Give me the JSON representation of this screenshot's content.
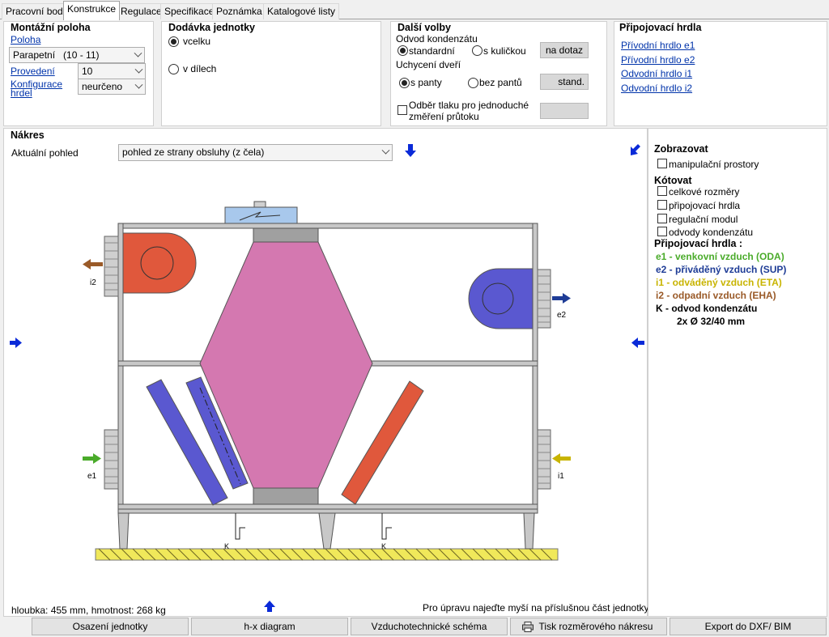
{
  "tabs": [
    "Pracovní bod",
    "Konstrukce",
    "Regulace",
    "Specifikace",
    "Poznámka",
    "Katalogové listy"
  ],
  "mount": {
    "title": "Montážní poloha",
    "poloha_link": "Poloha",
    "poloha_value": "Parapetní   (10 - 11)",
    "provedeni_link": "Provedení",
    "provedeni_value": "10",
    "konfig_link": "Konfigurace hrdel",
    "konfig_value": "neurčeno"
  },
  "delivery": {
    "title": "Dodávka jednotky",
    "opt1": "vcelku",
    "opt2": "v dílech"
  },
  "options": {
    "title": "Další volby",
    "odvod_label": "Odvod kondenzátu",
    "odvod_opt1": "standardní",
    "odvod_opt2": "s kuličkou",
    "odvod_btn": "na dotaz",
    "uchyceni_label": "Uchycení dveří",
    "uchyceni_opt1": "s panty",
    "uchyceni_opt2": "bez pantů",
    "uchyceni_btn": "stand.",
    "odber_label_1": "Odběr tlaku pro jednoduché",
    "odber_label_2": "změření průtoku"
  },
  "connections": {
    "title": "Připojovací hrdla",
    "links": [
      "Přívodní hrdlo e1",
      "Přívodní hrdlo e2",
      "Odvodní hrdlo i1",
      "Odvodní hrdlo i2"
    ]
  },
  "drawing": {
    "title": "Nákres",
    "view_label": "Aktuální pohled",
    "view_value": "pohled ze strany obsluhy (z čela)",
    "port_labels": {
      "i2": "i2",
      "e2": "e2",
      "e1": "e1",
      "i1": "i1",
      "k": "K"
    },
    "footer_left": "hloubka: 455 mm, hmotnost: 268 kg",
    "footer_right": "Pro úpravu najeďte myší na příslušnou část jednotky"
  },
  "side": {
    "zobrazovat": "Zobrazovat",
    "manip": "manipulační prostory",
    "kotovat": "Kótovat",
    "kot_items": [
      "celkové rozměry",
      "připojovací hrdla",
      "regulační modul",
      "odvody kondenzátu"
    ],
    "hrdla_title": "Připojovací hrdla :",
    "legend": [
      {
        "key": "e1",
        "text": "e1 - venkovní vzduch (ODA)",
        "color": "#4aab2a"
      },
      {
        "key": "e2",
        "text": "e2 - přiváděný vzduch (SUP)",
        "color": "#1e3c96"
      },
      {
        "key": "i1",
        "text": "i1 - odváděný vzduch (ETA)",
        "color": "#c8b400"
      },
      {
        "key": "i2",
        "text": "i2 - odpadní vzduch (EHA)",
        "color": "#9a5a28"
      },
      {
        "key": "k",
        "text": "K  - odvod kondenzátu",
        "color": "#000000"
      }
    ],
    "dims": "2x Ø 32/40 mm"
  },
  "bottom": {
    "b1": "Osazení jednotky",
    "b2": "h-x diagram",
    "b3": "Vzduchotechnické schéma",
    "b4": "Tisk rozměrového nákresu",
    "b5": "Export do DXF/ BIM"
  }
}
